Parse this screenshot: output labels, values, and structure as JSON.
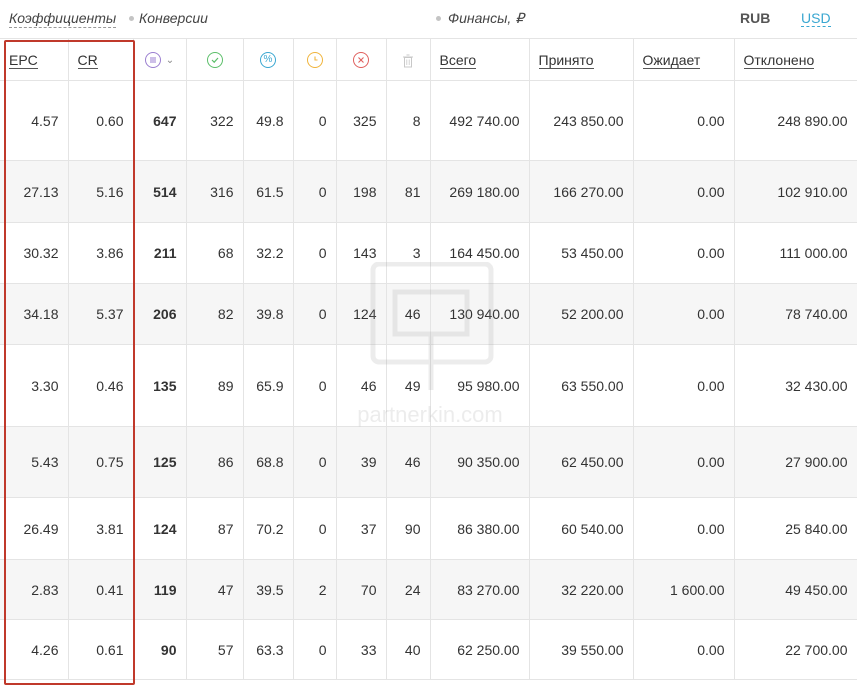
{
  "groups": {
    "coefficients": "Коэффициенты",
    "conversions": "Конверсии",
    "finances": "Финансы, ₽"
  },
  "currency": {
    "active": "RUB",
    "other": "USD"
  },
  "columns": {
    "epc": "EPC",
    "cr": "CR",
    "total": "Всего",
    "accepted": "Принято",
    "pending": "Ожидает",
    "rejected": "Отклонено"
  },
  "icons": [
    "list-sort-icon",
    "check-circle-icon",
    "percent-circle-icon",
    "clock-circle-icon",
    "cross-circle-icon",
    "trash-icon"
  ],
  "colors": {
    "accent": "#3aa7d1",
    "highlight": "#c0392b"
  },
  "rows": [
    {
      "epc": "4.57",
      "cr": "0.60",
      "all": "647",
      "approved": "322",
      "percent": "49.8",
      "hold": "0",
      "rejected": "325",
      "deleted": "8",
      "total": "492 740.00",
      "accepted": "243 850.00",
      "pending": "0.00",
      "declined": "248 890.00"
    },
    {
      "epc": "27.13",
      "cr": "5.16",
      "all": "514",
      "approved": "316",
      "percent": "61.5",
      "hold": "0",
      "rejected": "198",
      "deleted": "81",
      "total": "269 180.00",
      "accepted": "166 270.00",
      "pending": "0.00",
      "declined": "102 910.00"
    },
    {
      "epc": "30.32",
      "cr": "3.86",
      "all": "211",
      "approved": "68",
      "percent": "32.2",
      "hold": "0",
      "rejected": "143",
      "deleted": "3",
      "total": "164 450.00",
      "accepted": "53 450.00",
      "pending": "0.00",
      "declined": "111 000.00"
    },
    {
      "epc": "34.18",
      "cr": "5.37",
      "all": "206",
      "approved": "82",
      "percent": "39.8",
      "hold": "0",
      "rejected": "124",
      "deleted": "46",
      "total": "130 940.00",
      "accepted": "52 200.00",
      "pending": "0.00",
      "declined": "78 740.00"
    },
    {
      "epc": "3.30",
      "cr": "0.46",
      "all": "135",
      "approved": "89",
      "percent": "65.9",
      "hold": "0",
      "rejected": "46",
      "deleted": "49",
      "total": "95 980.00",
      "accepted": "63 550.00",
      "pending": "0.00",
      "declined": "32 430.00"
    },
    {
      "epc": "5.43",
      "cr": "0.75",
      "all": "125",
      "approved": "86",
      "percent": "68.8",
      "hold": "0",
      "rejected": "39",
      "deleted": "46",
      "total": "90 350.00",
      "accepted": "62 450.00",
      "pending": "0.00",
      "declined": "27 900.00"
    },
    {
      "epc": "26.49",
      "cr": "3.81",
      "all": "124",
      "approved": "87",
      "percent": "70.2",
      "hold": "0",
      "rejected": "37",
      "deleted": "90",
      "total": "86 380.00",
      "accepted": "60 540.00",
      "pending": "0.00",
      "declined": "25 840.00"
    },
    {
      "epc": "2.83",
      "cr": "0.41",
      "all": "119",
      "approved": "47",
      "percent": "39.5",
      "hold": "2",
      "rejected": "70",
      "deleted": "24",
      "total": "83 270.00",
      "accepted": "32 220.00",
      "pending": "1 600.00",
      "declined": "49 450.00"
    },
    {
      "epc": "4.26",
      "cr": "0.61",
      "all": "90",
      "approved": "57",
      "percent": "63.3",
      "hold": "0",
      "rejected": "33",
      "deleted": "40",
      "total": "62 250.00",
      "accepted": "39 550.00",
      "pending": "0.00",
      "declined": "22 700.00"
    }
  ],
  "watermark": "partnerkin.com"
}
